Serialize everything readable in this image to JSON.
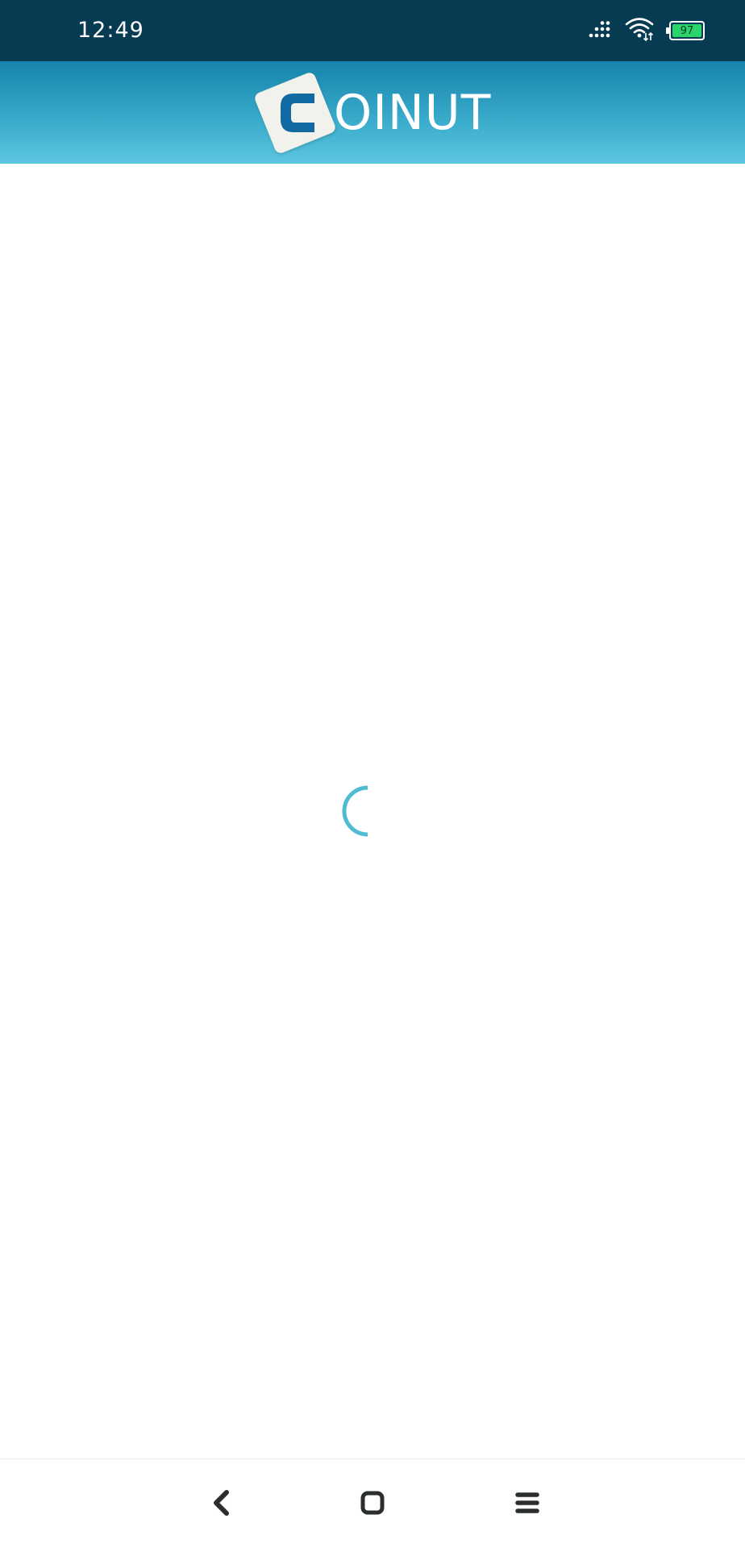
{
  "status_bar": {
    "time": "12:49",
    "battery_level": "97",
    "icons": [
      "signal-icon",
      "wifi-icon",
      "battery-icon"
    ]
  },
  "header": {
    "logo_letter": "C",
    "logo_text": "OINUT"
  },
  "content": {
    "loading_indicator": "spinner-icon"
  },
  "nav_bar": {
    "icons": [
      "back-icon",
      "home-icon",
      "menu-icon"
    ]
  },
  "colors": {
    "status_bar": "#073b52",
    "header_top": "#1583ab",
    "header_bottom": "#5cc6df",
    "logo_blue": "#136aa3",
    "spinner": "#4fbcd3",
    "battery_fill": "#2bd36b",
    "nav_icon": "#2b2f2b"
  }
}
